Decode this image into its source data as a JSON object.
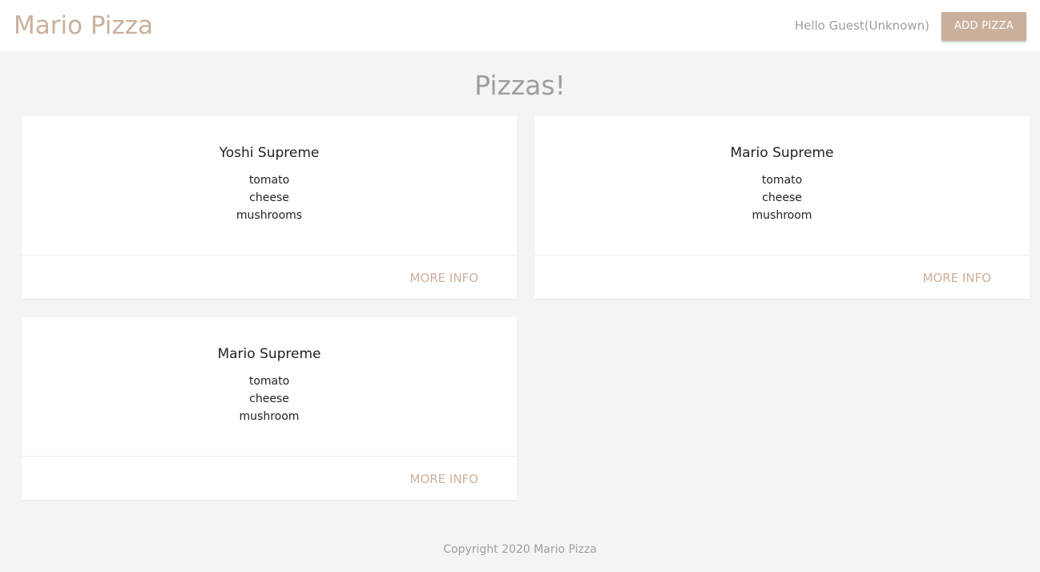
{
  "navbar": {
    "brand": "Mario Pizza",
    "greeting": "Hello Guest(Unknown)",
    "add_button_label": "ADD PIZZA"
  },
  "main": {
    "title": "Pizzas!",
    "pizzas": [
      {
        "title": "Yoshi Supreme",
        "ingredients": [
          "tomato",
          "cheese",
          "mushrooms"
        ],
        "action_label": "MORE INFO"
      },
      {
        "title": "Mario Supreme",
        "ingredients": [
          "tomato",
          "cheese",
          "mushroom"
        ],
        "action_label": "MORE INFO"
      },
      {
        "title": "Mario Supreme",
        "ingredients": [
          "tomato",
          "cheese",
          "mushroom"
        ],
        "action_label": "MORE INFO"
      }
    ]
  },
  "footer": {
    "copyright": "Copyright 2020 Mario Pizza"
  },
  "colors": {
    "brand": "#cbb09c",
    "background": "#f4f4f4",
    "muted_text": "#9e9e9e"
  }
}
